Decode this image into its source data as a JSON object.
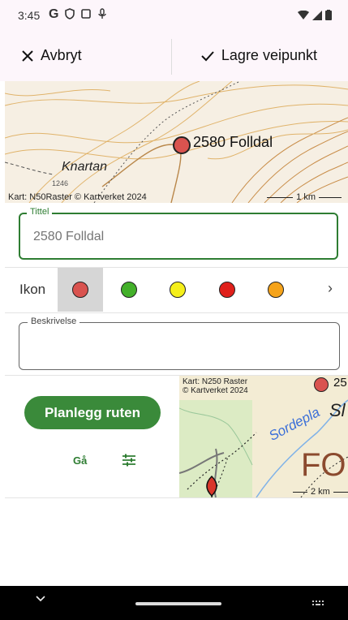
{
  "status": {
    "time": "3:45",
    "g": "G"
  },
  "actionbar": {
    "cancel_label": "Avbryt",
    "save_label": "Lagre veipunkt"
  },
  "map_top": {
    "pin_label": "2580 Folldal",
    "place": "Knartan",
    "credit": "Kart: N50Raster © Kartverket 2024",
    "scale": "1 km",
    "contour_label": "1246"
  },
  "title_field": {
    "label": "Tittel",
    "placeholder": "2580 Folldal"
  },
  "icon_row": {
    "label": "Ikon",
    "colors": [
      "#d9534f",
      "#43b02a",
      "#f5ef1a",
      "#e0201b",
      "#f5a31a"
    ],
    "selected": 0
  },
  "description": {
    "label": "Beskrivelse"
  },
  "planner": {
    "button_label": "Planlegg ruten",
    "mode_label": "Gå"
  },
  "map_bottom": {
    "credit_line1": "Kart: N250 Raster",
    "credit_line2": "© Kartverket 2024",
    "river": "Sordepla",
    "name_partial": "Sl",
    "area_partial": "FO",
    "pin_label_partial": "25",
    "scale": "2 km"
  }
}
